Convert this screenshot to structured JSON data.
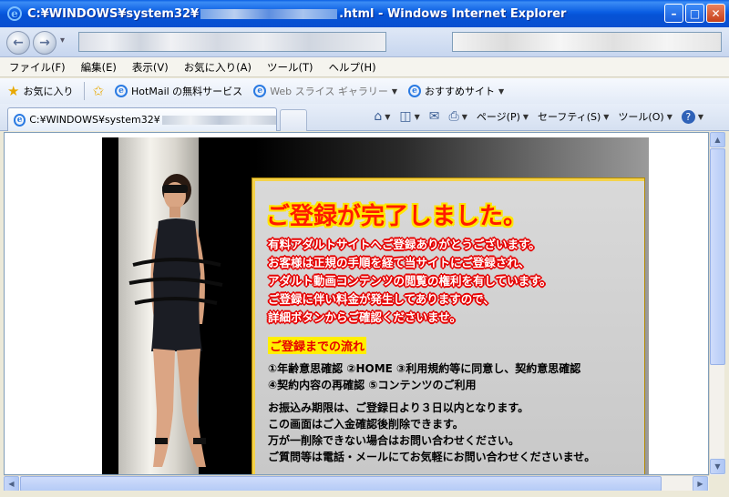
{
  "window": {
    "title_prefix": "C:¥WINDOWS¥system32¥",
    "title_suffix": ".html - Windows Internet Explorer",
    "minimize": "–",
    "maximize": "□",
    "close": "✕"
  },
  "nav": {
    "back_icon": "←",
    "forward_icon": "→",
    "dropdown_icon": "▾"
  },
  "menu": [
    "ファイル(F)",
    "編集(E)",
    "表示(V)",
    "お気に入り(A)",
    "ツール(T)",
    "ヘルプ(H)"
  ],
  "favorites": {
    "favorites_label": "お気に入り",
    "items": [
      "HotMail の無料サービス",
      "Web スライス ギャラリー",
      "おすすめサイト"
    ]
  },
  "tab": {
    "title_prefix": "C:¥WINDOWS¥system32¥"
  },
  "commands": {
    "home_icon": "⌂",
    "feeds_icon": "◫",
    "mail_icon": "✉",
    "print_icon": "⎙",
    "page": "ページ(P)",
    "safety": "セーフティ(S)",
    "tools": "ツール(O)",
    "help_icon": "?"
  },
  "content": {
    "headline": "ご登録が完了しました。",
    "red_lines": [
      "有料アダルトサイトへご登録ありがとうございます。",
      "お客様は正規の手順を経て当サイトにご登録され、",
      "アダルト動画コンテンツの閲覧の権利を有しています。",
      "ご登録に伴い料金が発生してありますので、",
      "詳細ボタンからご確認くださいませ。"
    ],
    "flow_heading": "ご登録までの流れ",
    "steps": [
      "①年齢意思確認 ②HOME ③利用規約等に同意し、契約意思確認",
      "④契約内容の再確認 ⑤コンテンツのご利用"
    ],
    "notes": [
      "お振込み期限は、ご登録日より３日以内となります。",
      "この画面はご入金確認後削除できます。",
      "万が一削除できない場合はお問い合わせください。",
      "ご質問等は電話・メールにてお気軽にお問い合わせくださいませ。"
    ]
  },
  "colors": {
    "titlebar_blue": "#0a5de2",
    "headline_red": "#ff1a00",
    "headline_outline": "#ffe600",
    "highlight_yellow": "#ffef00",
    "panel_gray": "#d0d0d0"
  },
  "icons": {
    "ie_logo": "e"
  }
}
